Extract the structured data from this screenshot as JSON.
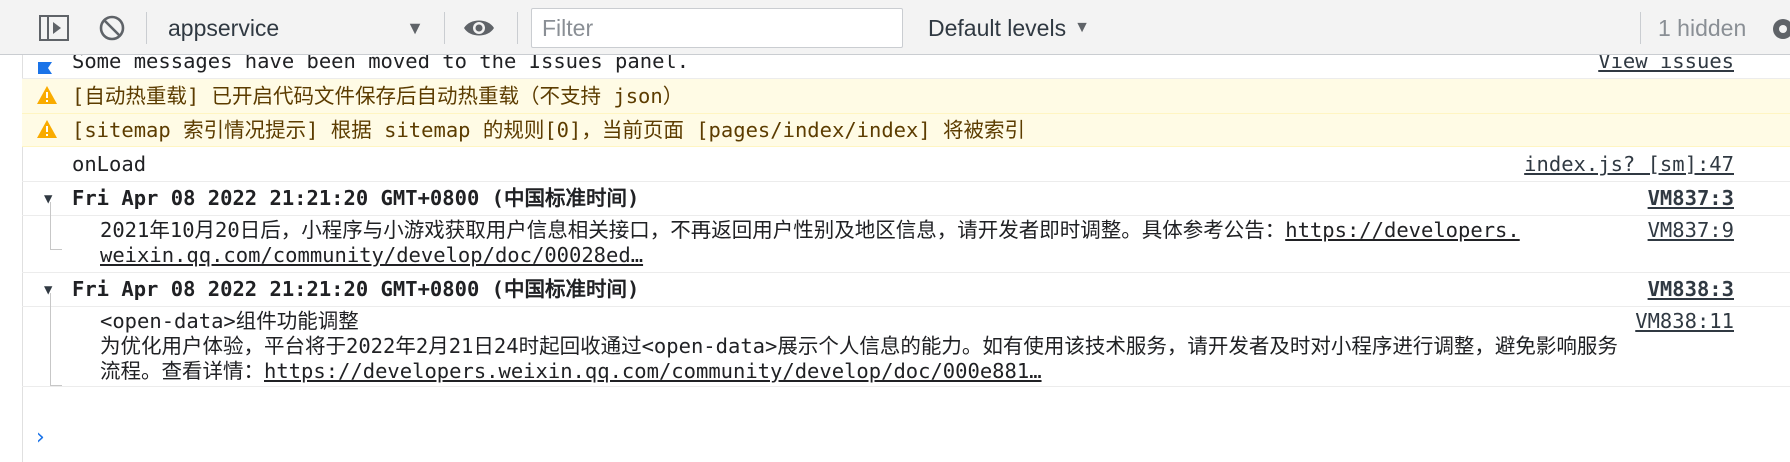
{
  "toolbar": {
    "context": "appservice",
    "filter_placeholder": "Filter",
    "levels_label": "Default levels",
    "hidden_label": "1 hidden"
  },
  "messages": {
    "issues_banner": {
      "text": "Some messages have been moved to the Issues panel.",
      "link": "View issues"
    },
    "warning1": {
      "text": "[自动热重载] 已开启代码文件保存后自动热重载（不支持 json）"
    },
    "warning2": {
      "text": "[sitemap 索引情况提示] 根据 sitemap 的规则[0]，当前页面 [pages/index/index] 将被索引"
    },
    "log1": {
      "text": "onLoad",
      "source": "index.js? [sm]:47"
    },
    "group1": {
      "title": "Fri Apr 08 2022 21:21:20 GMT+0800 (中国标准时间)",
      "source": "VM837:3",
      "child_line1": "2021年10月20日后，小程序与小游戏获取用户信息相关接口，不再返回用户性别及地区信息，请开发者即时调整。具体参考公告：",
      "child_link_part1": "https://developers.",
      "child_link_part2": "weixin.qq.com/community/develop/doc/00028ed…",
      "child_source": "VM837:9"
    },
    "group2": {
      "title": "Fri Apr 08 2022 21:21:20 GMT+0800 (中国标准时间)",
      "source": "VM838:3",
      "child_line1": "<open-data>组件功能调整",
      "child_line2": "为优化用户体验，平台将于2022年2月21日24时起回收通过<open-data>展示个人信息的能力。如有使用该技术服务，请开发者及时对小程序进行调整，避免影响服务",
      "child_line3_prefix": "流程。查看详情：",
      "child_link": "https://developers.weixin.qq.com/community/develop/doc/000e881…",
      "child_source": "VM838:11"
    }
  }
}
